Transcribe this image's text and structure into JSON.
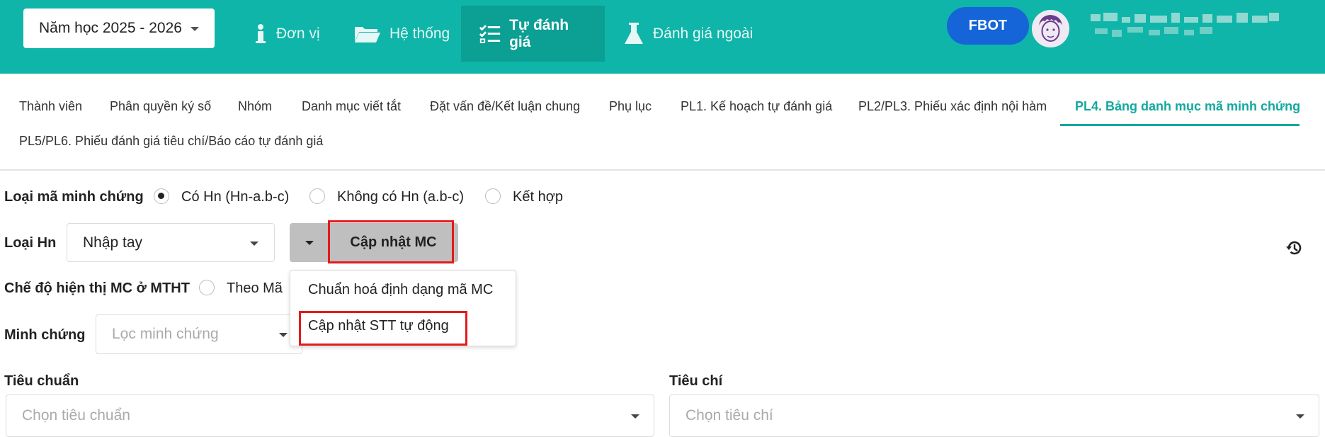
{
  "header": {
    "year_select": "Năm học 2025 - 2026",
    "nav": [
      {
        "label": "Đơn vị",
        "icon": "info-icon"
      },
      {
        "label": "Hệ thống",
        "icon": "folder-icon"
      },
      {
        "label": "Tự đánh giá",
        "icon": "checklist-icon",
        "active": true
      },
      {
        "label": "Đánh giá ngoài",
        "icon": "flask-icon"
      }
    ],
    "badge": "FBOT"
  },
  "tabs": [
    "Thành viên",
    "Phân quyền ký số",
    "Nhóm",
    "Danh mục viết tắt",
    "Đặt vấn đề/Kết luận chung",
    "Phụ lục",
    "PL1. Kế hoạch tự đánh giá",
    "PL2/PL3. Phiếu xác định nội hàm",
    "PL4. Bảng danh mục mã minh chứng",
    "PL5/PL6. Phiếu đánh giá tiêu chí/Báo cáo tự đánh giá"
  ],
  "form": {
    "loai_ma_label": "Loại mã minh chứng",
    "loai_ma_options": [
      "Có Hn (Hn-a.b-c)",
      "Không có Hn (a.b-c)",
      "Kết hợp"
    ],
    "loai_ma_selected": "Có Hn (Hn-a.b-c)",
    "loai_hn_label": "Loại Hn",
    "loai_hn_value": "Nhập tay",
    "update_button": "Cập nhật MC",
    "che_do_label": "Chế độ hiện thị MC ở MTHT",
    "che_do_option": "Theo Mã",
    "minh_chung_label": "Minh chứng",
    "minh_chung_placeholder": "Lọc minh chứng",
    "tieu_chuan_label": "Tiêu chuẩn",
    "tieu_chuan_placeholder": "Chọn tiêu chuẩn",
    "tieu_chi_label": "Tiêu chí",
    "tieu_chi_placeholder": "Chọn tiêu chí"
  },
  "dropdown": {
    "items": [
      "Chuẩn hoá định dạng mã MC",
      "Cập nhật STT tự động"
    ]
  },
  "colors": {
    "header_bg": "#0fb5a9",
    "active_nav_bg": "#0c9f94",
    "accent": "#13a89e",
    "badge_bg": "#1565d8",
    "highlight": "#e21b1b"
  }
}
